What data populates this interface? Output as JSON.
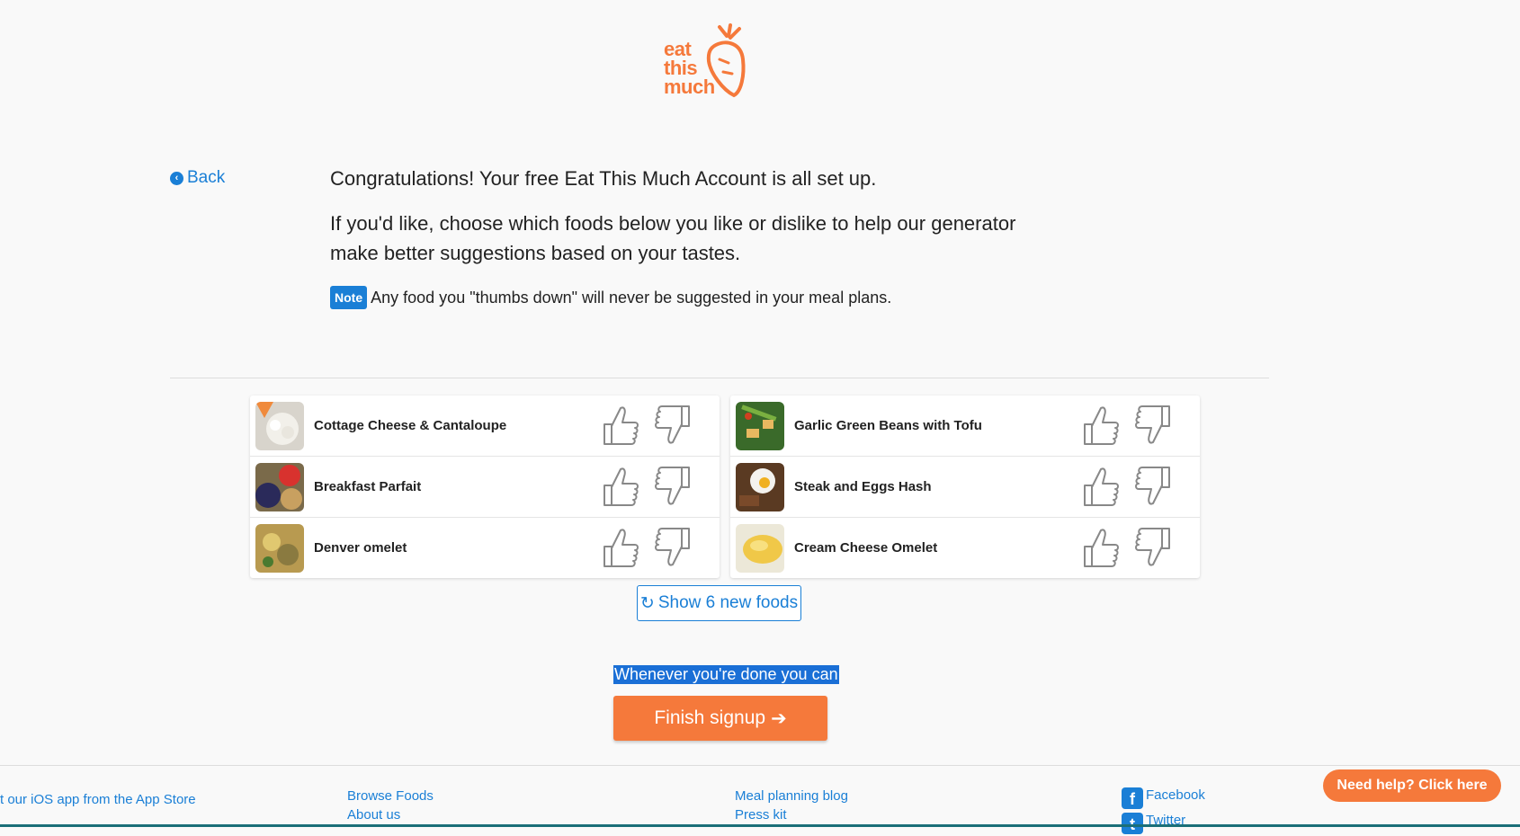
{
  "logo": {
    "line1": "eat",
    "line2": "this",
    "line3": "much"
  },
  "back": {
    "label": "Back"
  },
  "intro": {
    "congrats": "Congratulations! Your free Eat This Much Account is all set up.",
    "instructions": "If you'd like, choose which foods below you like or dislike to help our generator make better suggestions based on your tastes.",
    "note_badge": "Note",
    "note_text": "Any food you \"thumbs down\" will never be suggested in your meal plans."
  },
  "foods_left": [
    {
      "name": "Cottage Cheese & Cantaloupe",
      "icon": "cottage-cheese-thumb"
    },
    {
      "name": "Breakfast Parfait",
      "icon": "parfait-thumb"
    },
    {
      "name": "Denver omelet",
      "icon": "omelet-thumb"
    }
  ],
  "foods_right": [
    {
      "name": "Garlic Green Beans with Tofu",
      "icon": "green-beans-thumb"
    },
    {
      "name": "Steak and Eggs Hash",
      "icon": "steak-eggs-thumb"
    },
    {
      "name": "Cream Cheese Omelet",
      "icon": "cream-omelet-thumb"
    }
  ],
  "refresh": {
    "label": "Show 6 new foods"
  },
  "done": {
    "text": "Whenever you're done you can"
  },
  "finish": {
    "label": "Finish signup"
  },
  "footer": {
    "app_store": "t our iOS app from the App Store",
    "browse_foods": "Browse Foods",
    "about_us": "About us",
    "blog": "Meal planning blog",
    "press_kit": "Press kit",
    "facebook": "Facebook",
    "twitter": "Twitter"
  },
  "help": {
    "label": "Need help? Click here"
  },
  "colors": {
    "accent": "#f5793b",
    "link": "#1a7fd6",
    "background": "#f9f9f9"
  }
}
